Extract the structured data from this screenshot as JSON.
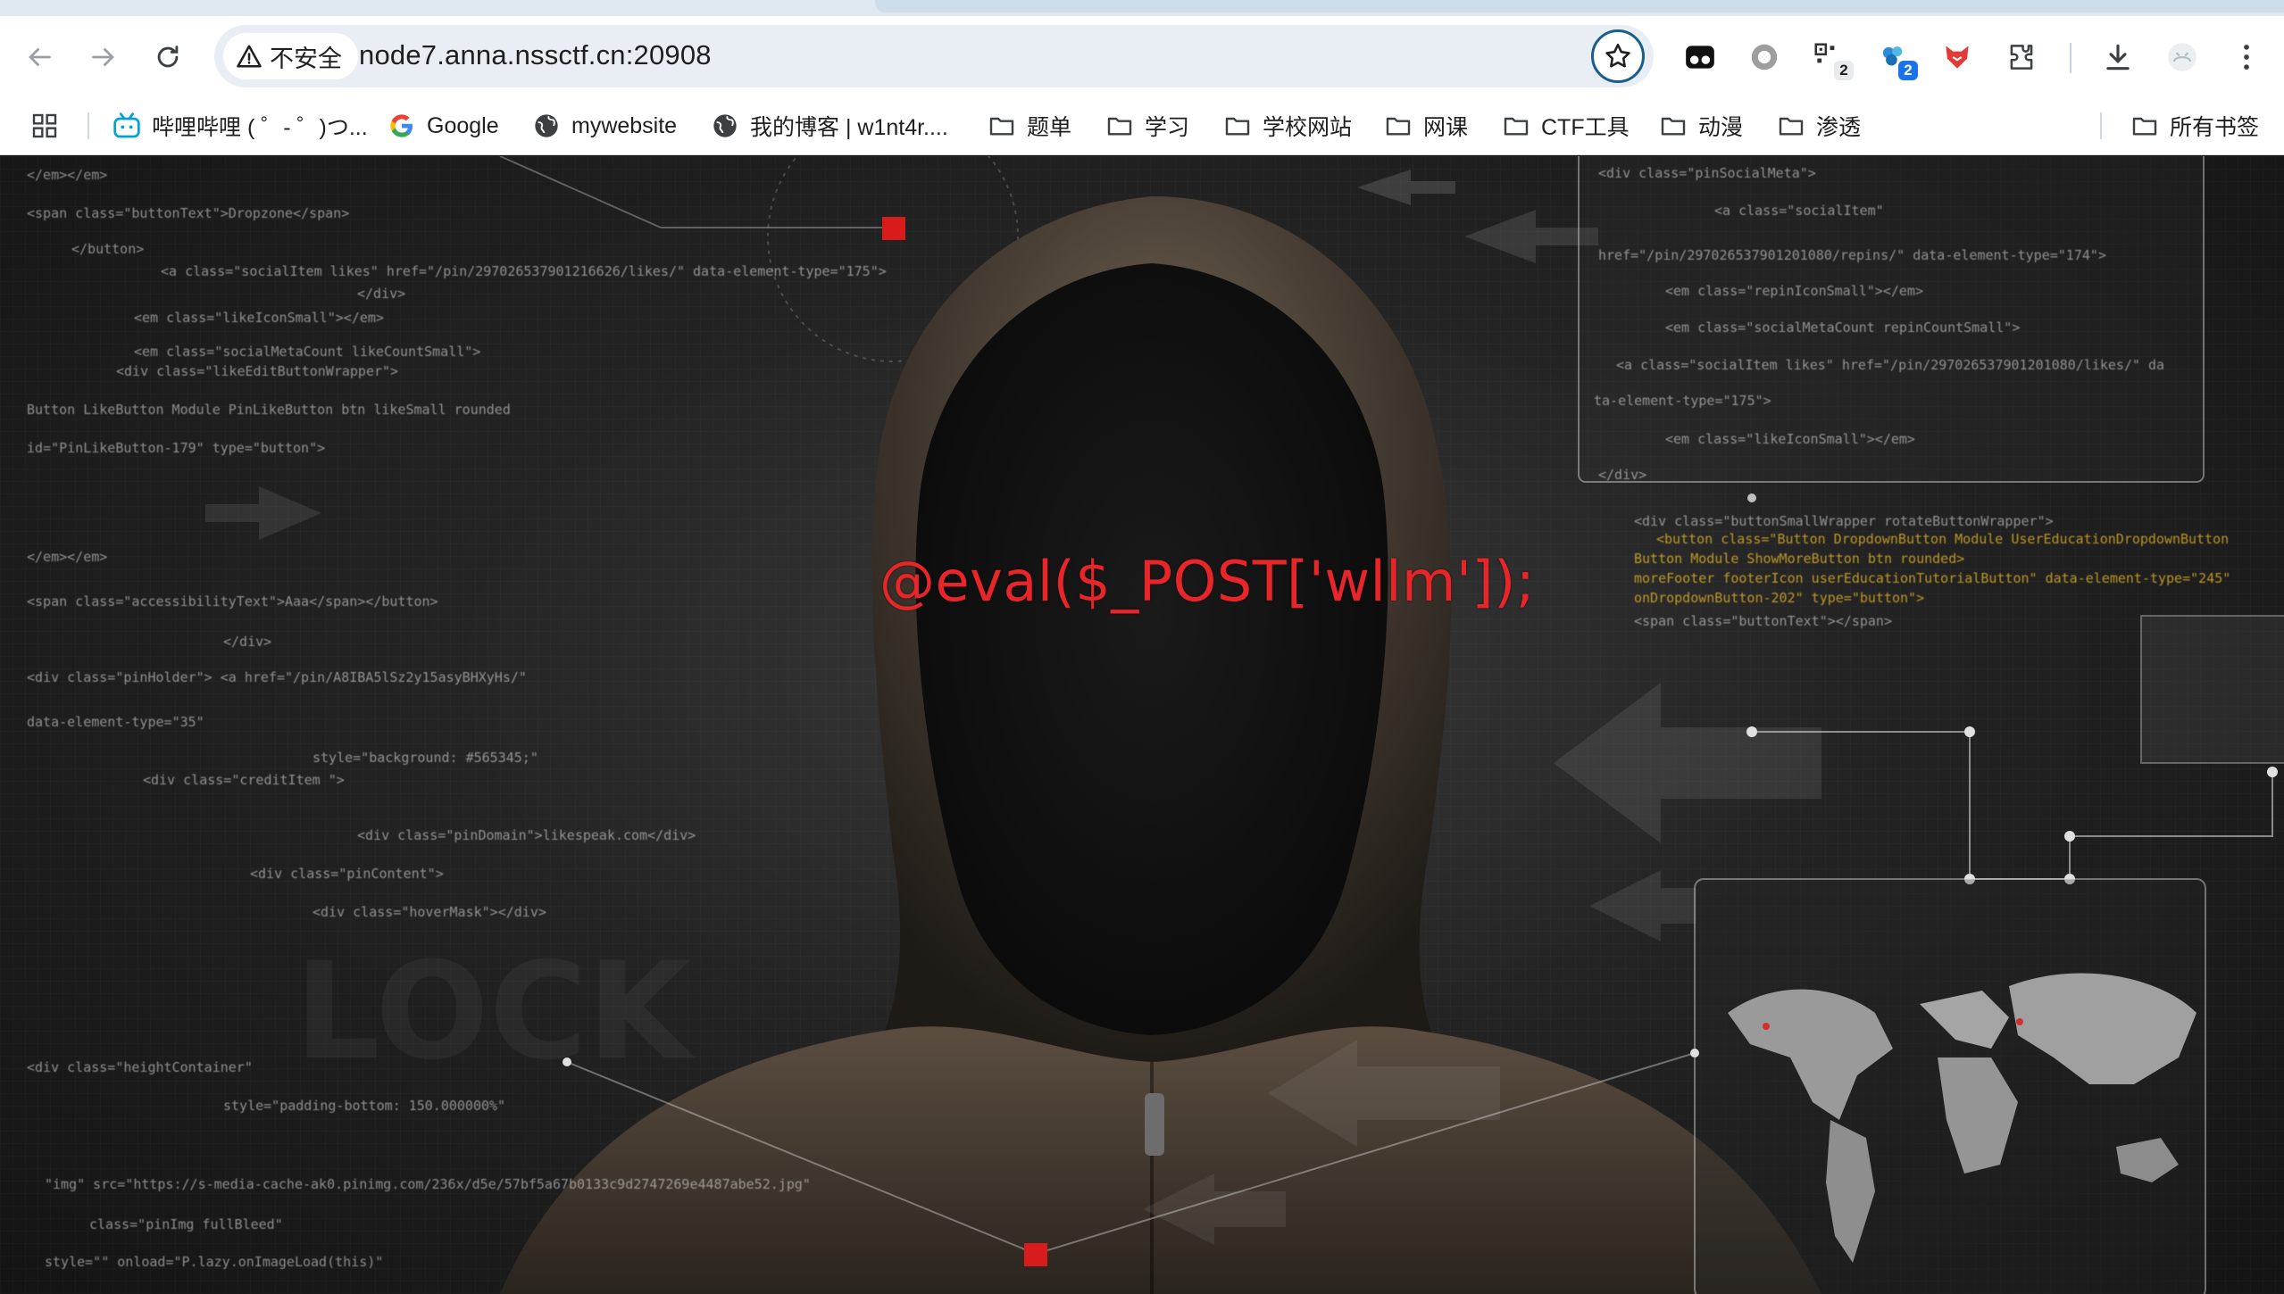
{
  "browser": {
    "security_label": "不安全",
    "url": "node7.anna.nssctf.cn:20908",
    "extensions": [
      {
        "name": "tampermonkey-icon",
        "badge": ""
      },
      {
        "name": "record-icon",
        "badge": ""
      },
      {
        "name": "qr-extension-icon",
        "badge": "2"
      },
      {
        "name": "wappalyzer-icon",
        "badge": "2"
      },
      {
        "name": "fox-extension-icon",
        "badge": ""
      },
      {
        "name": "extensions-puzzle-icon",
        "badge": ""
      }
    ]
  },
  "bookmarks": {
    "items": [
      {
        "label": "哔哩哔哩 ( ゜- ゜)つ...",
        "icon": "bilibili-icon"
      },
      {
        "label": "Google",
        "icon": "google-icon"
      },
      {
        "label": "mywebsite",
        "icon": "globe-icon"
      },
      {
        "label": "我的博客 | w1nt4r....",
        "icon": "globe-icon"
      },
      {
        "label": "题单",
        "icon": "folder-icon"
      },
      {
        "label": "学习",
        "icon": "folder-icon"
      },
      {
        "label": "学校网站",
        "icon": "folder-icon"
      },
      {
        "label": "网课",
        "icon": "folder-icon"
      },
      {
        "label": "CTF工具",
        "icon": "folder-icon"
      },
      {
        "label": "动漫",
        "icon": "folder-icon"
      },
      {
        "label": "渗透",
        "icon": "folder-icon"
      }
    ],
    "all_bookmarks": "所有书签"
  },
  "page": {
    "payload_text": "@eval($_POST['wllm']);",
    "payload_color": "#e8262a"
  }
}
